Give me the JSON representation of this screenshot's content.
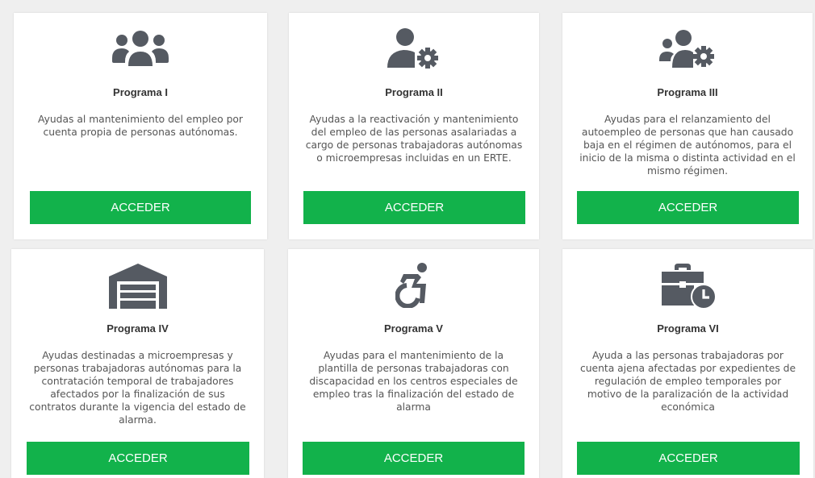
{
  "colors": {
    "button": "#12b24b",
    "icon": "#555a62",
    "background": "#efefef"
  },
  "programs": [
    {
      "icon": "users-group-icon",
      "title": "Programa I",
      "description": "Ayudas al mantenimiento del empleo por cuenta propia de personas autónomas.",
      "button": "ACCEDER"
    },
    {
      "icon": "user-gear-icon",
      "title": "Programa II",
      "description": "Ayudas a la reactivación y mantenimiento del empleo de las personas asalariadas a cargo de personas trabajadoras autónomas o microempresas incluidas en un ERTE.",
      "button": "ACCEDER"
    },
    {
      "icon": "users-gear-icon",
      "title": "Programa III",
      "description": "Ayudas para el relanzamiento del autoempleo de personas que han causado baja en el régimen de autónomos, para el inicio de la misma o distinta actividad en el mismo régimen.",
      "button": "ACCEDER"
    },
    {
      "icon": "warehouse-icon",
      "title": "Programa IV",
      "description": "Ayudas destinadas a microempresas y personas trabajadoras autónomas para la contratación temporal de trabajadores afectados por la finalización de sus contratos durante la vigencia del estado de alarma.",
      "button": "ACCEDER"
    },
    {
      "icon": "accessible-icon",
      "title": "Programa V",
      "description": "Ayudas para el mantenimiento de la plantilla de personas trabajadoras con discapacidad en los centros especiales de empleo tras la finalización del estado de alarma",
      "button": "ACCEDER"
    },
    {
      "icon": "business-time-icon",
      "title": "Programa VI",
      "description": "Ayuda a las personas trabajadoras por cuenta ajena afectadas por expedientes de regulación de empleo temporales por motivo de la paralización de la actividad económica",
      "button": "ACCEDER"
    }
  ]
}
